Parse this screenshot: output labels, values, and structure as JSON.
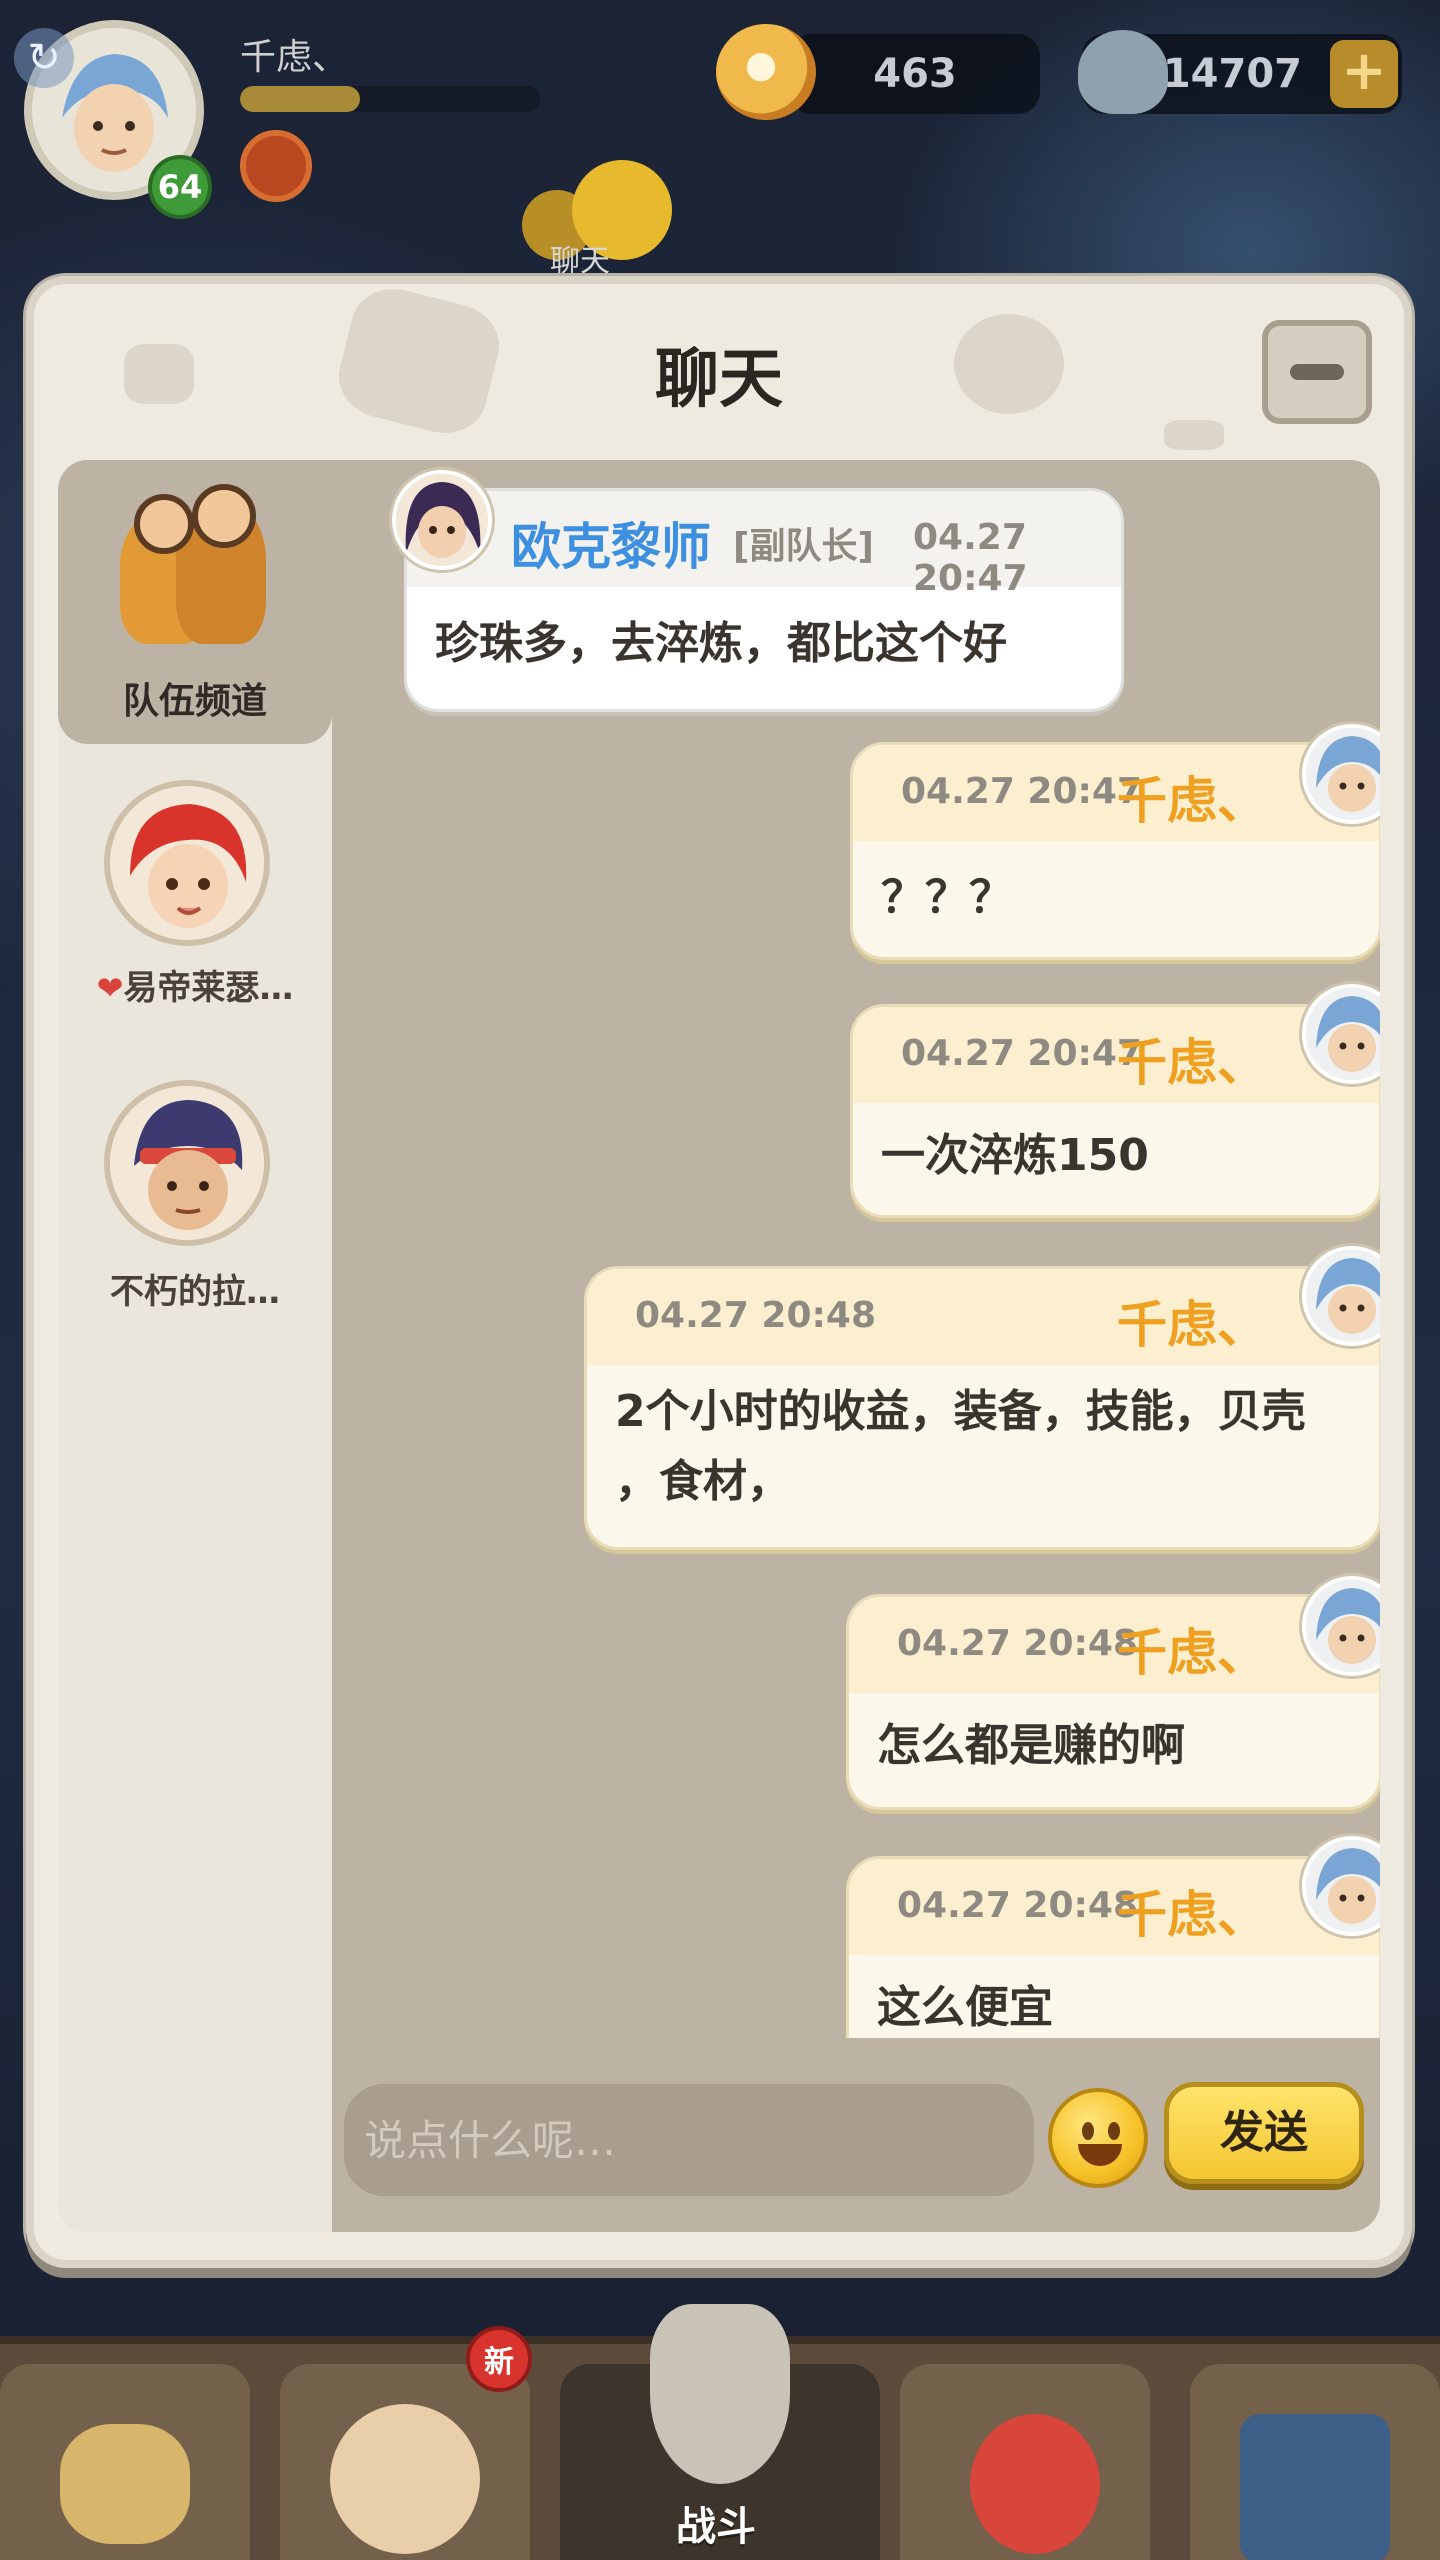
{
  "hud": {
    "player_name": "千虑、",
    "level": "64",
    "exp_progress": 0.4,
    "pearls": "463",
    "shells": "14707",
    "chat_icon_label": "聊天"
  },
  "chat": {
    "title": "聊天",
    "channels": [
      {
        "label": "队伍频道",
        "active": true
      },
      {
        "label": "易帝莱瑟…"
      },
      {
        "label": "不朽的拉…"
      }
    ],
    "messages": [
      {
        "sender": "欧克黎师",
        "role": "[副队长]",
        "time": "04.27 20:47",
        "text": "珍珠多，去淬炼，都比这个好",
        "self": false
      },
      {
        "sender": "千虑、",
        "time": "04.27 20:47",
        "text": "？？？",
        "self": true
      },
      {
        "sender": "千虑、",
        "time": "04.27 20:47",
        "text": "一次淬炼150",
        "self": true
      },
      {
        "sender": "千虑、",
        "time": "04.27 20:48",
        "text_line1": "2个小时的收益，装备，技能，贝壳",
        "text_line2": "，食材，",
        "self": true
      },
      {
        "sender": "千虑、",
        "time": "04.27 20:48",
        "text": "怎么都是赚的啊",
        "self": true
      },
      {
        "sender": "千虑、",
        "time": "04.27 20:48",
        "text": "这么便宜",
        "self": true
      }
    ],
    "input_placeholder": "说点什么呢…",
    "send_label": "发送"
  },
  "nav": {
    "badge": "新",
    "battle_label": "战斗"
  },
  "colors": {
    "self_name": "#efa021",
    "other_name": "#3d8fe0",
    "send_button": "#f4c630"
  }
}
